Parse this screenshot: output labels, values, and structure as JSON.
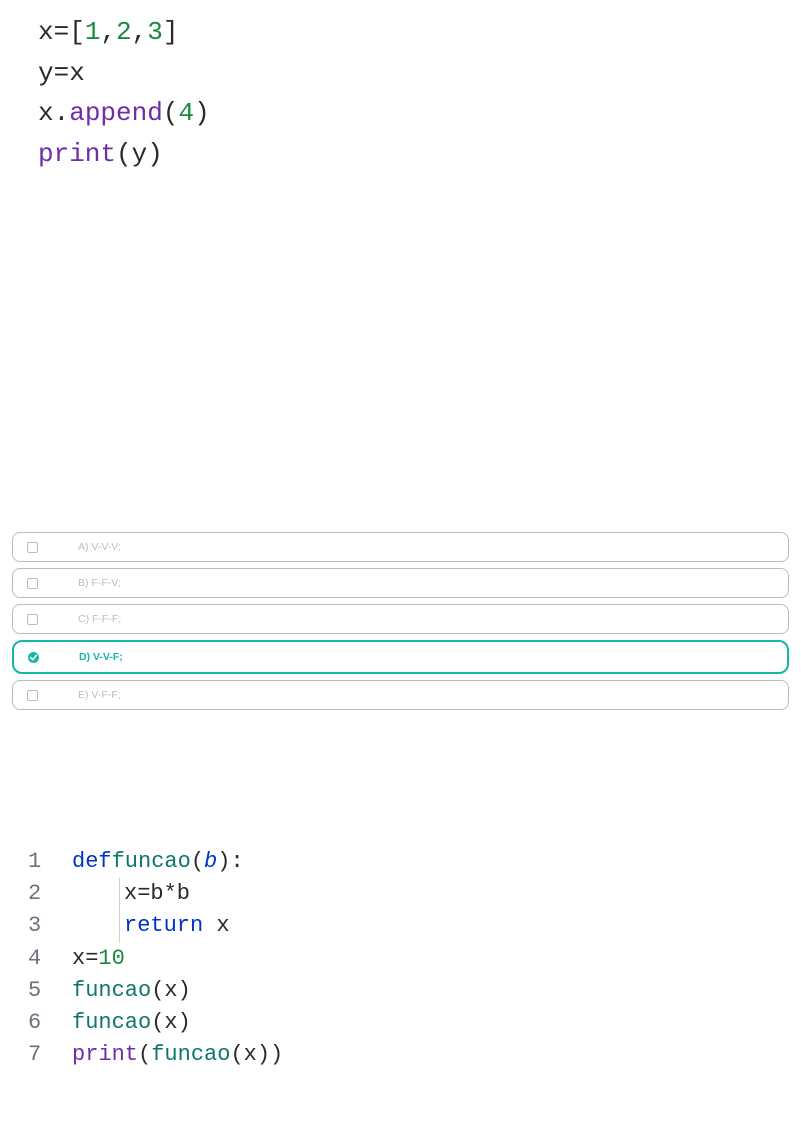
{
  "code1": {
    "l1": {
      "x": "x",
      "eq": " = ",
      "br_o": "[",
      "n1": "1",
      "c1": ",",
      "n2": "2",
      "c2": ",",
      "n3": "3",
      "br_c": "]"
    },
    "l2": {
      "y": "y",
      "eq": " = ",
      "x": "x"
    },
    "l3": {
      "x": "x",
      "dot": ".",
      "fn": "append",
      "po": "(",
      "n": "4",
      "pc": ")"
    },
    "l4": {
      "fn": "print",
      "po": "(",
      "y": "y",
      "pc": ")"
    }
  },
  "options": {
    "a": "A) V-V-V;",
    "b": "B) F-F-V;",
    "c": "C) F-F-F;",
    "d": "D) V-V-F;",
    "e": "E) V-F-F;"
  },
  "code2": {
    "l1": {
      "no": "1",
      "kw": "def",
      "sp": " ",
      "name": "funcao",
      "po": "(",
      "param": "b",
      "pc": ")",
      "colon": ":"
    },
    "l2": {
      "no": "2",
      "body": "x=b*b"
    },
    "l3": {
      "no": "3",
      "kw": "return",
      "sp": " ",
      "x": "x"
    },
    "l4": {
      "no": "4",
      "x": "x",
      "eq": " = ",
      "n": "10"
    },
    "l5": {
      "no": "5",
      "fn": "funcao",
      "po": "(",
      "x": "x",
      "pc": ")"
    },
    "l6": {
      "no": "6",
      "fn": "funcao",
      "po": "(",
      "x": "x",
      "pc": ")"
    },
    "l7": {
      "no": "7",
      "fn": "print",
      "po": "(",
      "fn2": "funcao",
      "po2": "(",
      "x": "x",
      "pc2": ")",
      "pc": ")"
    }
  }
}
